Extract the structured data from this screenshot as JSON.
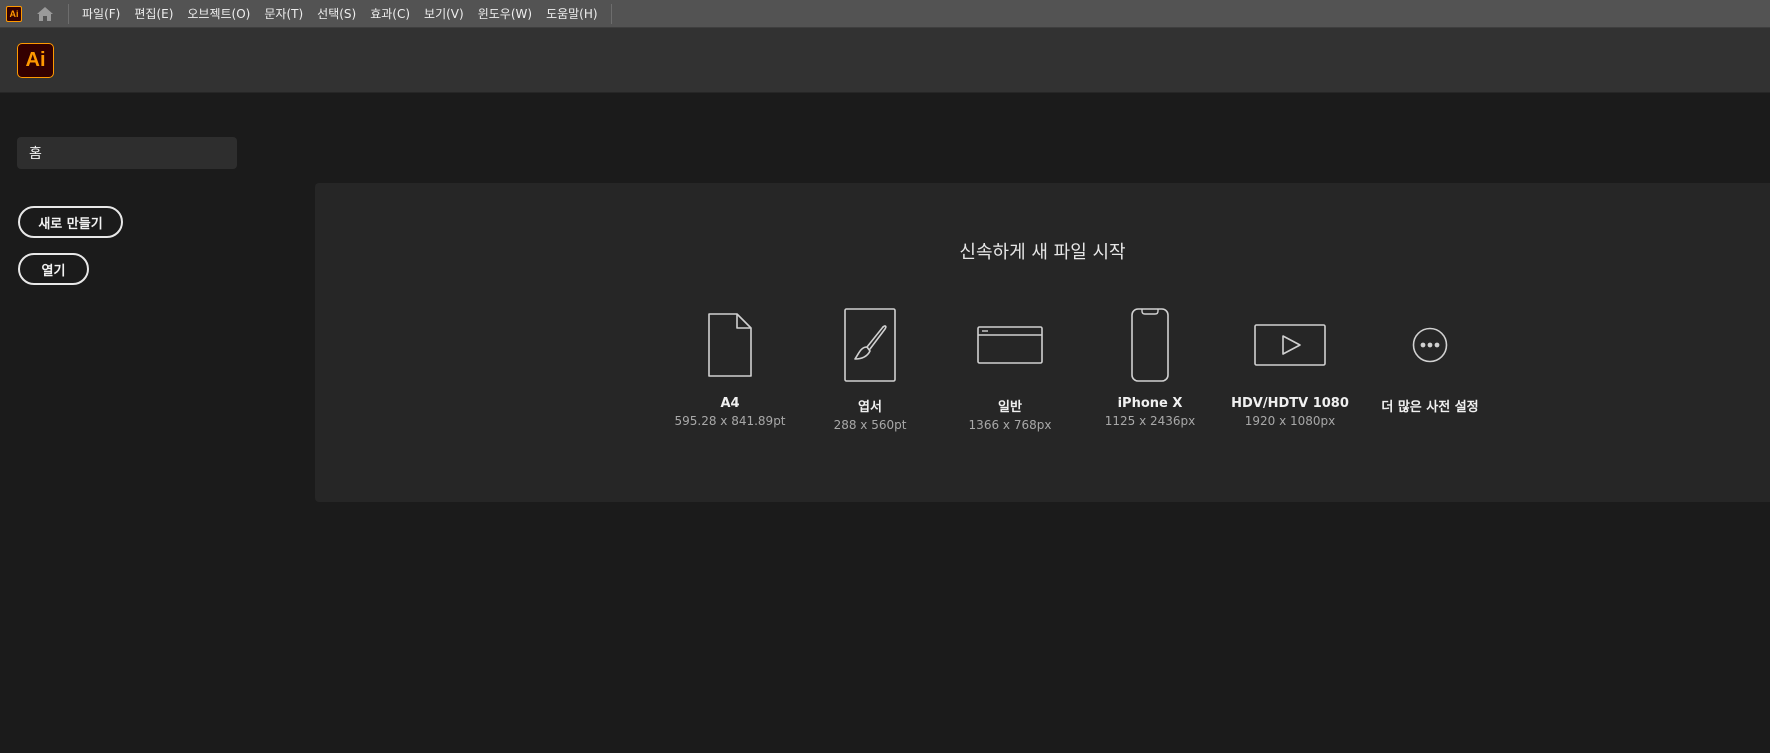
{
  "menubar": {
    "app_badge": "Ai",
    "items": [
      {
        "label": "파일(F)"
      },
      {
        "label": "편집(E)"
      },
      {
        "label": "오브젝트(O)"
      },
      {
        "label": "문자(T)"
      },
      {
        "label": "선택(S)"
      },
      {
        "label": "효과(C)"
      },
      {
        "label": "보기(V)"
      },
      {
        "label": "윈도우(W)"
      },
      {
        "label": "도움말(H)"
      }
    ]
  },
  "header": {
    "logo_text": "Ai"
  },
  "sidebar": {
    "home_label": "홈",
    "new_button": "새로 만들기",
    "open_button": "열기"
  },
  "quickstart": {
    "title": "신속하게 새 파일 시작",
    "presets": [
      {
        "name": "A4",
        "dims": "595.28 x 841.89pt",
        "icon": "document-icon"
      },
      {
        "name": "엽서",
        "dims": "288 x 560pt",
        "icon": "brush-page-icon"
      },
      {
        "name": "일반",
        "dims": "1366 x 768px",
        "icon": "browser-window-icon"
      },
      {
        "name": "iPhone X",
        "dims": "1125 x 2436px",
        "icon": "phone-icon"
      },
      {
        "name": "HDV/HDTV 1080",
        "dims": "1920 x 1080px",
        "icon": "video-play-icon"
      },
      {
        "name": "더 많은 사전 설정",
        "dims": "",
        "icon": "more-ellipsis-icon"
      }
    ]
  },
  "colors": {
    "accent": "#ff9a00",
    "logo_bg": "#330000",
    "menubar_bg": "#535353",
    "header_bg": "#323232",
    "app_bg": "#1b1b1b",
    "panel_bg": "#262626"
  }
}
